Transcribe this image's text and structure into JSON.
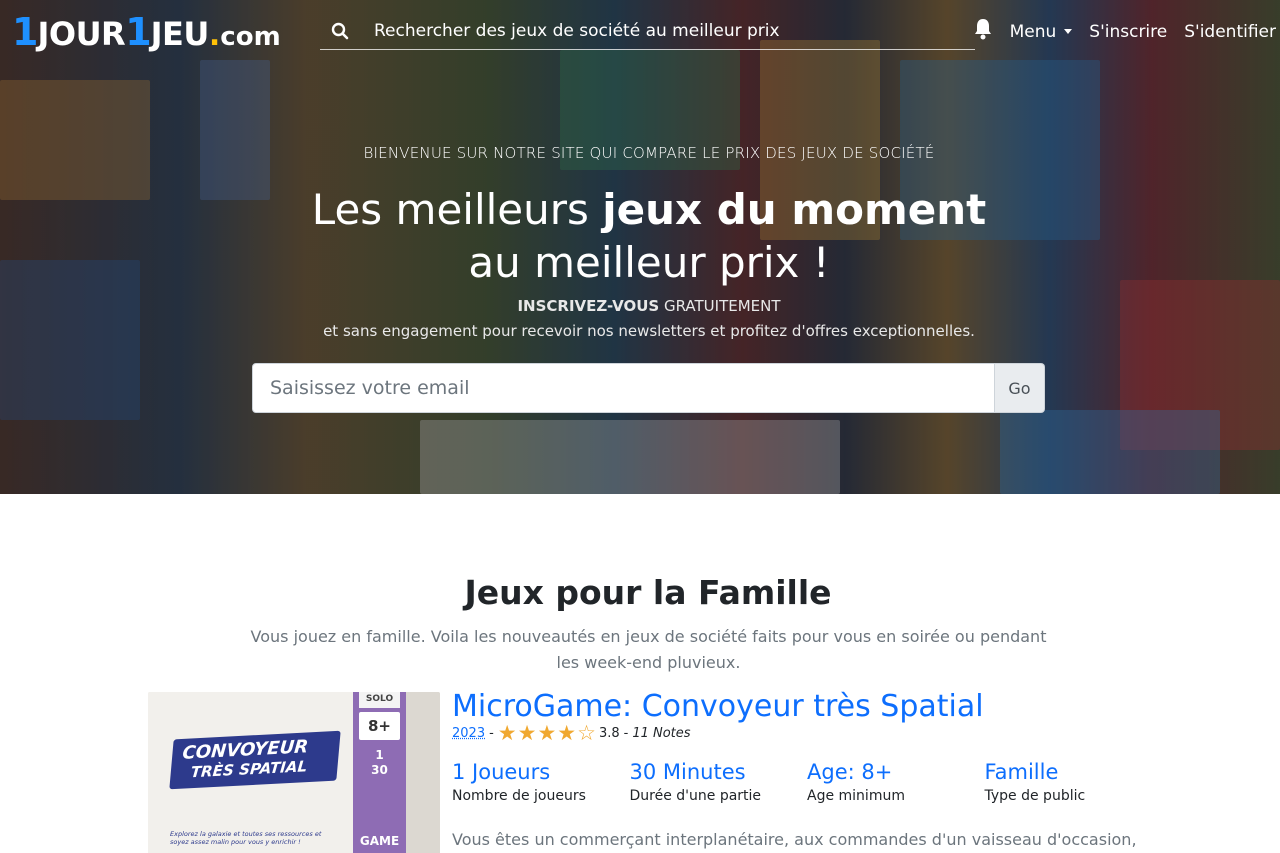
{
  "navbar": {
    "logo": {
      "part1": "1",
      "part2": "JOUR",
      "part3": "1",
      "part4": "JEU",
      "part5": ".",
      "part6": "com"
    },
    "search_placeholder": "Rechercher des jeux de société au meilleur prix",
    "menu_label": "Menu",
    "signup_label": "S'inscrire",
    "login_label": "S'identifier"
  },
  "hero": {
    "welcome": "BIENVENUE SUR NOTRE SITE QUI COMPARE LE PRIX DES JEUX DE SOCIÉTÉ",
    "headline_pre": "Les meilleurs ",
    "headline_bold": "jeux du moment",
    "headline_line2": "au meilleur prix !",
    "signup_bold": "INSCRIVEZ-VOUS",
    "signup_rest": " GRATUITEMENT",
    "subline": "et sans engagement pour recevoir nos newsletters et profitez d'offres exceptionnelles.",
    "email_placeholder": "Saisissez votre email",
    "go_label": "Go"
  },
  "section": {
    "title": "Jeux pour la Famille",
    "description": "Vous jouez en famille. Voila les nouveautés en jeux de société faits pour vous en soirée ou pendant les week-end pluvieux."
  },
  "game": {
    "title": "MicroGame: Convoyeur très Spatial",
    "year": "2023",
    "separator": "-",
    "rating": 3.8,
    "rating_text": "3.8",
    "notes": "11 Notes",
    "stats": [
      {
        "value": "1 Joueurs",
        "label": "Nombre de joueurs"
      },
      {
        "value": "30 Minutes",
        "label": "Durée d'une partie"
      },
      {
        "value": "Age: 8+",
        "label": "Age minimum"
      },
      {
        "value": "Famille",
        "label": "Type de public"
      }
    ],
    "description": "Vous êtes un commerçant interplanétaire, aux commandes d'un vaisseau d'occasion,",
    "image": {
      "box_title_line1": "CONVOYEUR",
      "box_title_line2": "TRÈS SPATIAL",
      "box_desc": "Explorez la galaxie et toutes ses ressources et soyez assez malin pour vous y enrichir !",
      "solo": "SOLO",
      "age": "8+",
      "players": "1",
      "minutes": "30",
      "brand": "GAME"
    }
  },
  "colors": {
    "link_blue": "#0d6efd",
    "logo_blue": "#1e90ff",
    "star_gold": "#f0a830"
  }
}
